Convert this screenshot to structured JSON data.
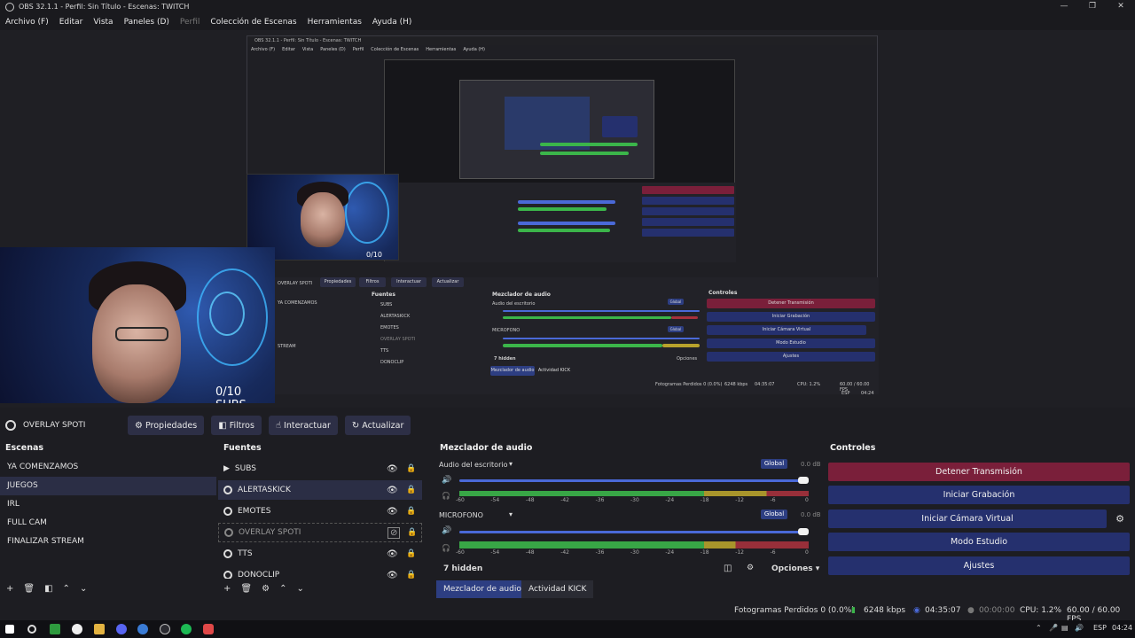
{
  "window": {
    "title": "OBS 32.1.1 - Perfil: Sin Título - Escenas: TWITCH",
    "controls": [
      "—",
      "❐",
      "✕"
    ]
  },
  "menu": [
    "Archivo (F)",
    "Editar",
    "Vista",
    "Paneles (D)",
    "Perfil",
    "Colección de Escenas",
    "Herramientas",
    "Ayuda (H)"
  ],
  "preview": {
    "overlay_text_large": "0/10 SUBS",
    "overlay_text_medium": "0/10 SUBS",
    "inner": {
      "title": "OBS 32.1.1 - Perfil: Sin Título - Escenas: TWITCH",
      "menu": [
        "Archivo (F)",
        "Editar",
        "Vista",
        "Paneles (D)",
        "Perfil",
        "Colección de Escenas",
        "Herramientas",
        "Ayuda (H)"
      ],
      "toolbar": [
        "Propiedades",
        "Filtros",
        "Interactuar",
        "Actualizar"
      ],
      "source_name": "OVERLAY SPOTI",
      "scenes": [
        "YA COMENZAMOS",
        "STREAM"
      ],
      "sources_title": "Fuentes",
      "sources": [
        "SUBS",
        "ALERTASKICK",
        "EMOTES",
        "OVERLAY SPOTI",
        "TTS",
        "DONOCLIP"
      ],
      "mixer_title": "Mezclador de audio",
      "mixer_desktop": "Audio del escritorio",
      "mixer_mic": "MICROFONO",
      "hidden": "7 hidden",
      "options": "Opciones",
      "tab_mixer": "Mezclador de audio",
      "tab_kick": "Actividad KICK",
      "controls_title": "Controles",
      "controls": [
        "Detener Transmisión",
        "Iniciar Grabación",
        "Iniciar Cámara Virtual",
        "Modo Estudio",
        "Ajustes"
      ],
      "status": "Fotogramas Perdidos 0 (0.0%)",
      "kbps": "6248 kbps",
      "time": "04:35:07",
      "fps": "60.00 / 60.00 FPS",
      "cpu": "CPU: 1.2%",
      "tray_lang": "ESP",
      "tray_time": "04:24",
      "global": "Global"
    }
  },
  "source_toolbar": {
    "source_name": "OVERLAY SPOTI",
    "buttons": [
      {
        "label": "Propiedades",
        "icon": "gear-icon"
      },
      {
        "label": "Filtros",
        "icon": "filter-icon"
      },
      {
        "label": "Interactuar",
        "icon": "hand-icon"
      },
      {
        "label": "Actualizar",
        "icon": "refresh-icon"
      }
    ]
  },
  "scenes": {
    "title": "Escenas",
    "items": [
      "YA COMENZAMOS",
      "JUEGOS",
      "IRL",
      "FULL CAM",
      "FINALIZAR STREAM"
    ],
    "selected_index": 1
  },
  "sources": {
    "title": "Fuentes",
    "items": [
      {
        "name": "SUBS",
        "icon": "audio-icon",
        "hidden": false
      },
      {
        "name": "ALERTASKICK",
        "icon": "browser-icon",
        "hidden": false
      },
      {
        "name": "EMOTES",
        "icon": "browser-icon",
        "hidden": false
      },
      {
        "name": "OVERLAY SPOTI",
        "icon": "browser-icon",
        "hidden": true
      },
      {
        "name": "TTS",
        "icon": "browser-icon",
        "hidden": false
      },
      {
        "name": "DONOCLIP",
        "icon": "browser-icon",
        "hidden": false
      }
    ],
    "selected_index": 1
  },
  "mixer": {
    "title": "Mezclador de audio",
    "channels": [
      {
        "name": "Audio del escritorio",
        "global": "Global",
        "db": "0.0 dB",
        "level": 0.88
      },
      {
        "name": "MICROFONO",
        "global": "Global",
        "db": "0.0 dB",
        "level": 0.79
      }
    ],
    "scale": [
      "-60",
      "-54",
      "-48",
      "-42",
      "-36",
      "-30",
      "-24",
      "-18",
      "-12",
      "-6",
      "0"
    ],
    "hidden": "7 hidden",
    "options": "Opciones",
    "tabs": [
      "Mezclador de audio",
      "Actividad KICK"
    ]
  },
  "controls": {
    "title": "Controles",
    "buttons": [
      {
        "label": "Detener Transmisión",
        "color": "#7a1f3a"
      },
      {
        "label": "Iniciar Grabación",
        "color": "#25306e"
      },
      {
        "label": "Iniciar Cámara Virtual",
        "color": "#25306e"
      },
      {
        "label": "Modo Estudio",
        "color": "#25306e"
      },
      {
        "label": "Ajustes",
        "color": "#25306e"
      }
    ]
  },
  "status": {
    "dropped": "Fotogramas Perdidos 0 (0.0%)",
    "kbps": "6248 kbps",
    "stream_time": "04:35:07",
    "rec_time": "00:00:00",
    "cpu": "CPU: 1.2%",
    "fps": "60.00 / 60.00 FPS"
  },
  "taskbar": {
    "lang": "ESP",
    "time": "04:24"
  },
  "colors": {
    "accent": "#2d3e82",
    "stop_stream": "#7a1f3a",
    "meter_green": "#3bb54a",
    "meter_yellow": "#b8a22c",
    "meter_red": "#a6313c"
  }
}
